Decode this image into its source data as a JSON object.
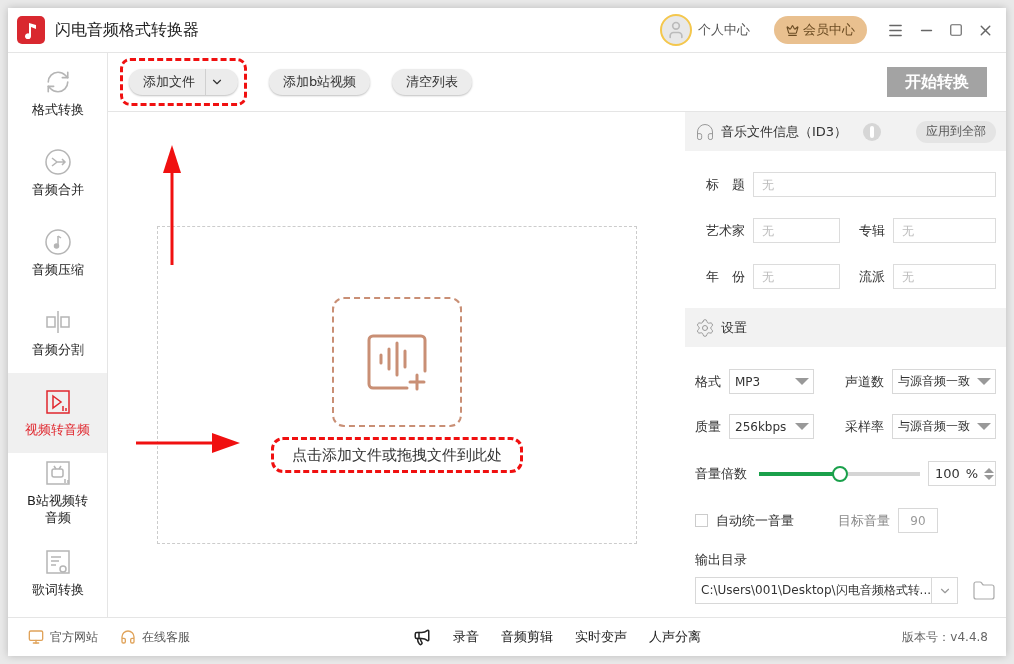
{
  "window": {
    "title": "闪电音频格式转换器"
  },
  "header": {
    "user": "个人中心",
    "vip": "会员中心"
  },
  "sidebar": {
    "items": [
      {
        "label": "格式转换",
        "selected": false
      },
      {
        "label": "音频合并",
        "selected": false
      },
      {
        "label": "音频压缩",
        "selected": false
      },
      {
        "label": "音频分割",
        "selected": false
      },
      {
        "label": "视频转音频",
        "selected": true
      },
      {
        "label": "B站视频转音频",
        "selected": false
      },
      {
        "label": "歌词转换",
        "selected": false
      }
    ]
  },
  "toolbar": {
    "add_file": "添加文件",
    "add_bili": "添加b站视频",
    "clear": "清空列表",
    "start": "开始转换"
  },
  "drop_zone": {
    "hint": "点击添加文件或拖拽文件到此处"
  },
  "id3": {
    "title": "音乐文件信息（ID3）",
    "apply_all": "应用到全部",
    "fields": [
      {
        "label": "标　题",
        "placeholder": "无"
      },
      {
        "label": "艺术家",
        "placeholder": "无"
      },
      {
        "label": "专辑",
        "placeholder": "无"
      },
      {
        "label": "年　份",
        "placeholder": "无"
      },
      {
        "label": "流派",
        "placeholder": "无"
      }
    ]
  },
  "settings": {
    "title": "设置",
    "selects": [
      {
        "label": "格式",
        "value": "MP3"
      },
      {
        "label": "声道数",
        "value": "与源音频一致"
      },
      {
        "label": "质量",
        "value": "256kbps"
      },
      {
        "label": "采样率",
        "value": "与源音频一致"
      }
    ],
    "volume": {
      "label": "音量倍数",
      "level": 0.5,
      "value": "100",
      "unit": "%"
    },
    "auto_volume": {
      "label": "自动统一音量",
      "checked": false
    },
    "target": {
      "label": "目标音量",
      "value": "90"
    },
    "output": {
      "label": "输出目录",
      "value": "C:\\Users\\001\\Desktop\\闪电音频格式转..."
    }
  },
  "footer": {
    "links": [
      "官方网站",
      "在线客服"
    ],
    "tools": [
      "录音",
      "音频剪辑",
      "实时变声",
      "人声分离"
    ],
    "version": "版本号：v4.4.8"
  }
}
